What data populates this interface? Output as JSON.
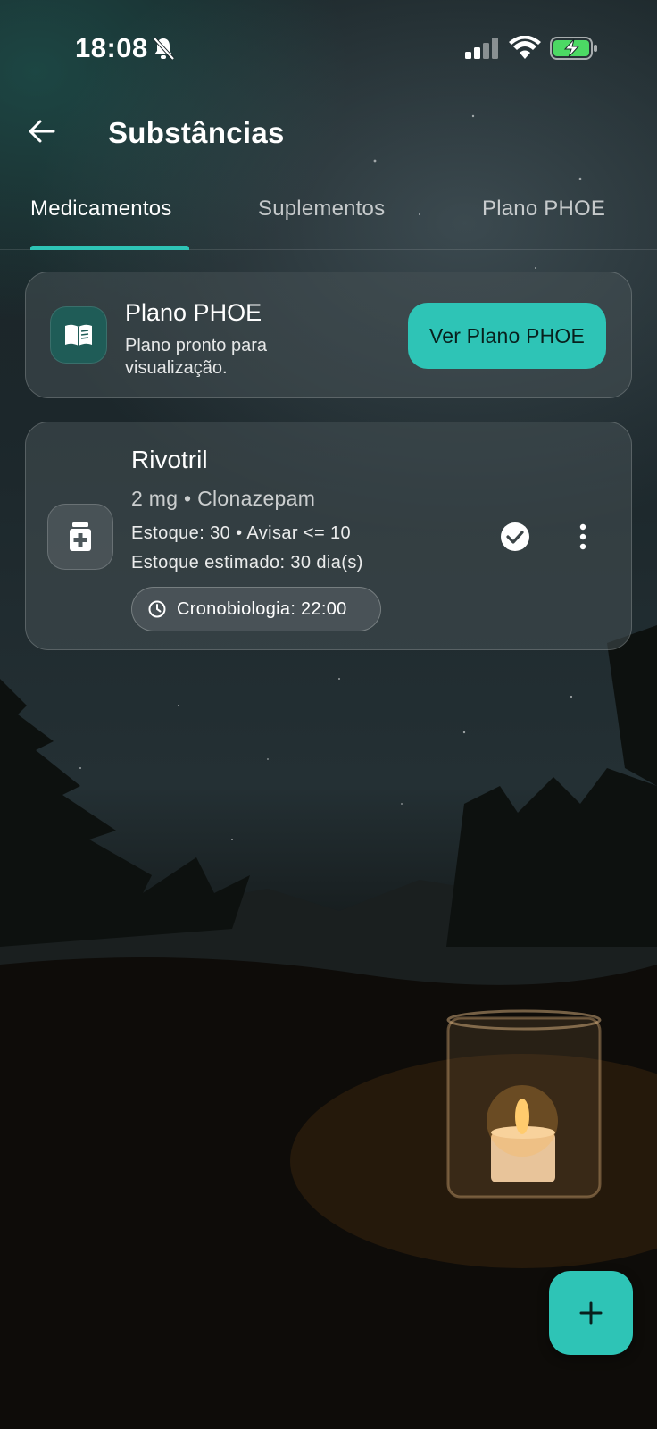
{
  "status_bar": {
    "time": "18:08",
    "icons": [
      "bell-off-icon",
      "signal-icon",
      "wifi-icon",
      "battery-charging-icon"
    ]
  },
  "header": {
    "title": "Substâncias",
    "back_icon": "arrow-left-icon"
  },
  "tabs": [
    {
      "label": "Medicamentos",
      "active": true
    },
    {
      "label": "Suplementos",
      "active": false
    },
    {
      "label": "Plano PHOE",
      "active": false
    }
  ],
  "plan_card": {
    "icon": "book-icon",
    "title": "Plano PHOE",
    "subtitle": "Plano pronto para visualização.",
    "button_label": "Ver Plano PHOE"
  },
  "medications": [
    {
      "icon": "medicine-bottle-icon",
      "name": "Rivotril",
      "dose_line": "2 mg • Clonazepam",
      "stock_line": "Estoque: 30 • Avisar <= 10",
      "estimate_line": "Estoque estimado: 30 dia(s)",
      "chrono_label": "Cronobiologia: 22:00"
    }
  ],
  "fab": {
    "icon": "plus-icon"
  },
  "colors": {
    "accent": "#2ec4b6",
    "card_bg": "#464f53",
    "text": "#ffffff"
  }
}
